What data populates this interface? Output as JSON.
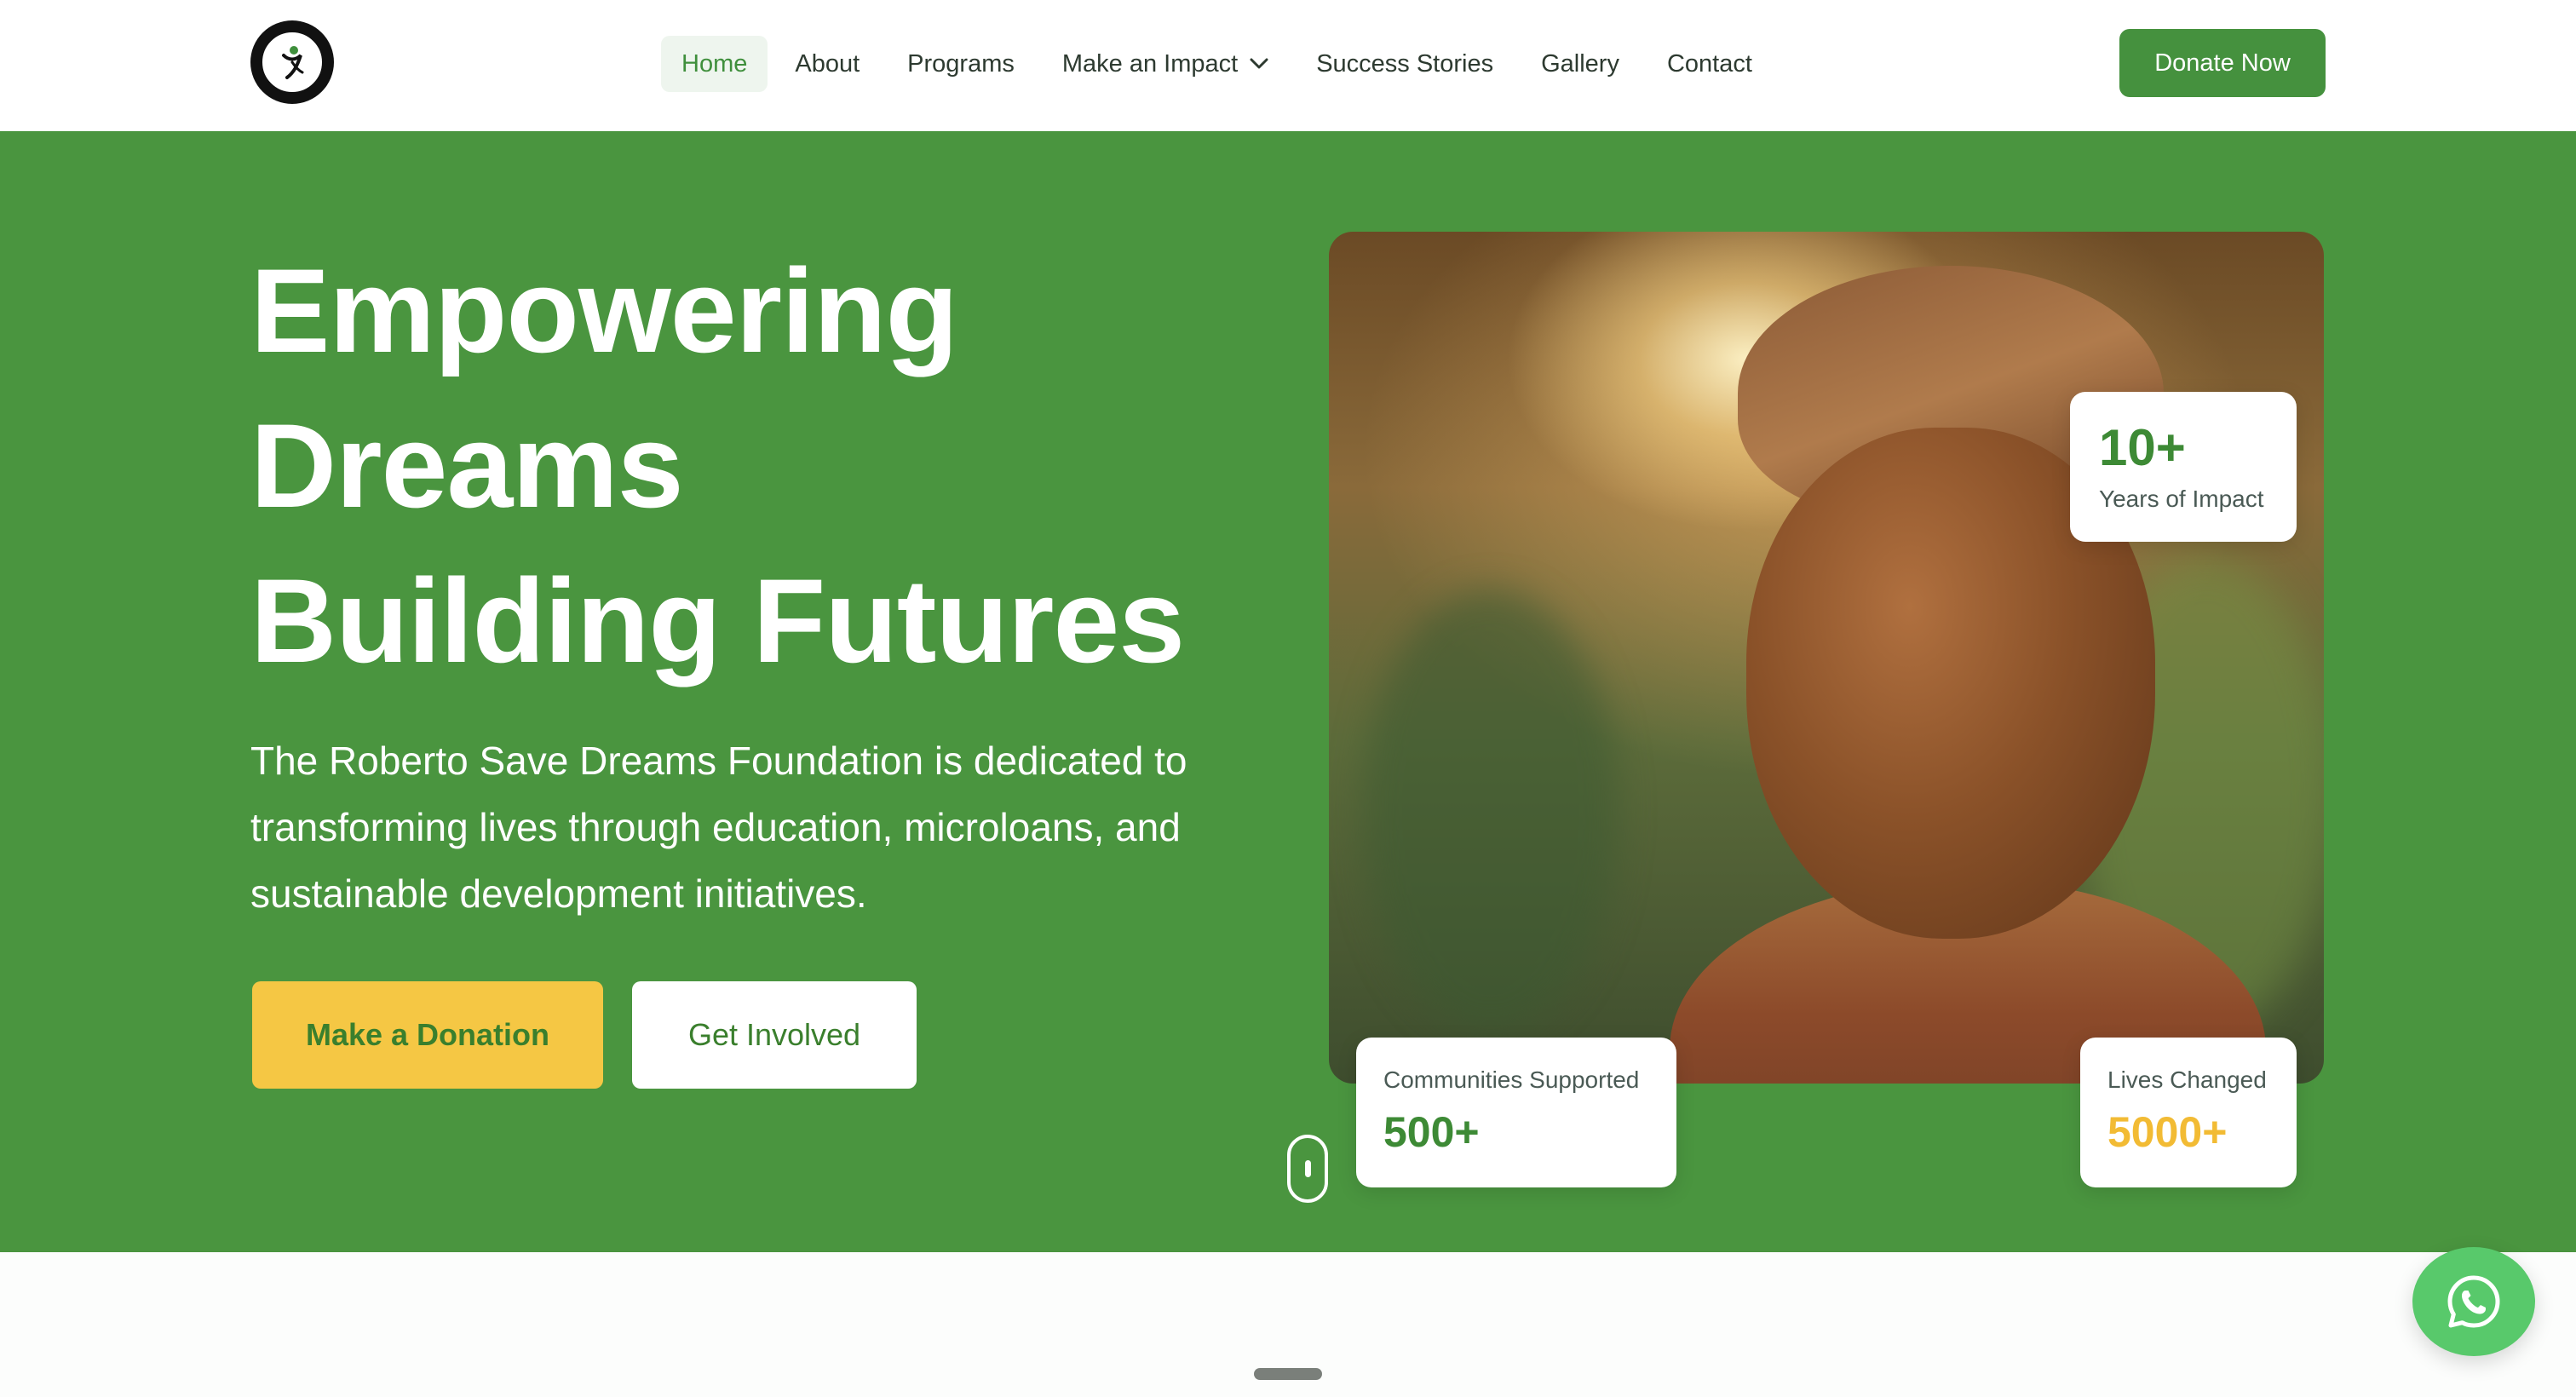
{
  "brand": {
    "logo_icon": "foundation-logo-icon"
  },
  "nav": {
    "items": [
      {
        "label": "Home",
        "active": true
      },
      {
        "label": "About",
        "active": false
      },
      {
        "label": "Programs",
        "active": false
      },
      {
        "label": "Make an Impact",
        "active": false,
        "has_dropdown": true
      },
      {
        "label": "Success Stories",
        "active": false
      },
      {
        "label": "Gallery",
        "active": false
      },
      {
        "label": "Contact",
        "active": false
      }
    ],
    "cta": "Donate Now"
  },
  "hero": {
    "title_lines": [
      "Empowering",
      "Dreams",
      "Building Futures"
    ],
    "subtitle": "The Roberto Save Dreams Foundation is dedicated to transforming lives through education, microloans, and sustainable development initiatives.",
    "primary_button": "Make a Donation",
    "secondary_button": "Get Involved"
  },
  "stats": {
    "years": {
      "value": "10+",
      "label": "Years of Impact"
    },
    "communities": {
      "label": "Communities Supported",
      "value": "500+"
    },
    "lives": {
      "label": "Lives Changed",
      "value": "5000+"
    }
  },
  "colors": {
    "brand_green": "#4a953f",
    "button_green": "#45913e",
    "accent_yellow": "#f5c744",
    "whatsapp_green": "#58c96b"
  },
  "icons": {
    "dropdown": "chevron-down-icon",
    "scroll": "scroll-mouse-icon",
    "chat": "whatsapp-icon"
  }
}
